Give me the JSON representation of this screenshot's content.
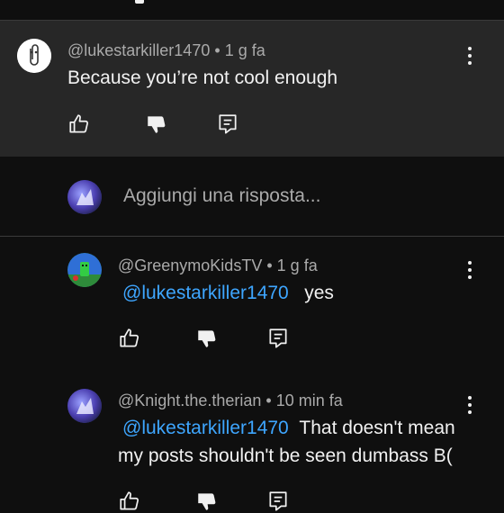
{
  "top_comment": {
    "author": "@lukestarkiller1470",
    "time": "1 g fa",
    "text": "Because you’re not cool enough",
    "avatar_icon": "paperclip-icon"
  },
  "reply_input": {
    "placeholder": "Aggiungi una risposta..."
  },
  "replies": [
    {
      "author": "@GreenymoKidsTV",
      "time": "1 g fa",
      "mention": "@lukestarkiller1470",
      "text": "yes"
    },
    {
      "author": "@Knight.the.therian",
      "time": "10 min fa",
      "mention": "@lukestarkiller1470",
      "text_line1": "That doesn't mean",
      "text_line2": "my posts shouldn't be seen dumbass B("
    }
  ],
  "separator": "•",
  "colors": {
    "background": "#0f0f0f",
    "highlight": "#272727",
    "mention": "#3ea6ff",
    "meta": "#aaaaaa"
  }
}
